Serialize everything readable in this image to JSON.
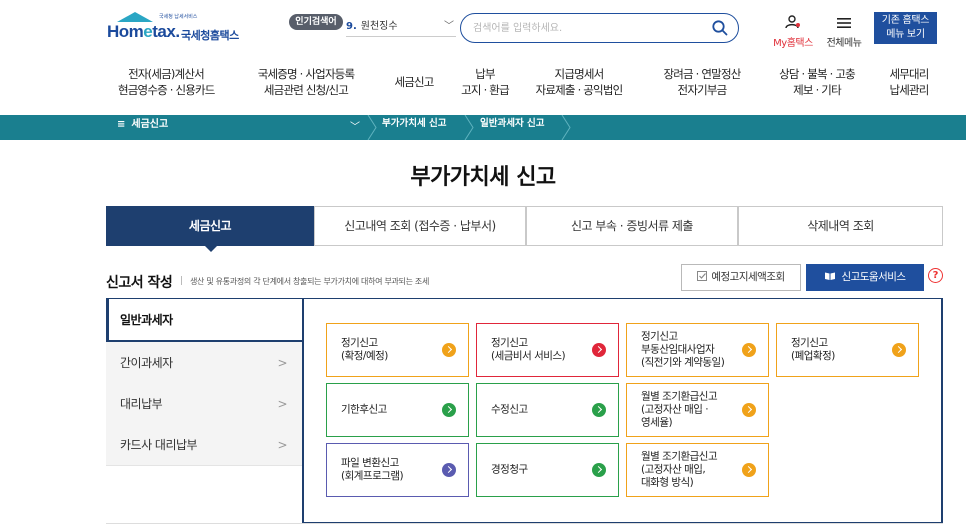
{
  "header": {
    "logo_text_a": "Hom",
    "logo_text_e": "e",
    "logo_text_b": "tax.",
    "logo_sub": "국세청홈택스",
    "logo_tiny": "국세청 납세서비스",
    "popular_badge": "인기검색어",
    "popular_num": "9.",
    "popular_term": "원천징수",
    "search_placeholder": "검색어를 입력하세요.",
    "my_hometax": "My홈택스",
    "all_menu": "전체메뉴",
    "old_hometax_line1": "기존 홈택스",
    "old_hometax_line2": "메뉴 보기"
  },
  "gnb": [
    {
      "line1": "전자(세금)계산서",
      "line2": "현금영수증 · 신용카드"
    },
    {
      "line1": "국세증명 · 사업자등록",
      "line2": "세금관련 신청/신고"
    },
    {
      "line1": "세금신고",
      "line2": ""
    },
    {
      "line1": "납부",
      "line2": "고지 · 환급"
    },
    {
      "line1": "지급명세서",
      "line2": "자료제출 · 공익법인"
    },
    {
      "line1": "장려금 · 연말정산",
      "line2": "전자기부금"
    },
    {
      "line1": "상담 · 불복 · 고충",
      "line2": "제보 · 기타"
    },
    {
      "line1": "세무대리",
      "line2": "납세관리"
    }
  ],
  "location": {
    "menu": "세금신고",
    "crumb1": "부가가치세 신고",
    "crumb2": "일반과세자 신고"
  },
  "page_title": "부가가치세 신고",
  "tabs": [
    "세금신고",
    "신고내역 조회 (접수증 · 납부서)",
    "신고 부속 · 증빙서류 제출",
    "삭제내역 조회"
  ],
  "section": {
    "title": "신고서 작성",
    "desc": "생산 및 유통과정의 각 단계에서 창출되는 부가가치에 대하여 부과되는 조세",
    "btn_notice": "예정고지세액조회",
    "btn_help": "신고도움서비스",
    "help_mark": "?"
  },
  "side_menu": [
    "일반과세자",
    "간이과세자",
    "대리납부",
    "카드사 대리납부"
  ],
  "colors": {
    "orange": "#f0a21a",
    "red": "#e0263a",
    "green": "#2aa04a",
    "purple": "#5a5bb0",
    "navy": "#1e3f6f",
    "teal": "#1a7f8f"
  },
  "cards": [
    {
      "label": "정기신고\n(확정/예정)",
      "color": "orange"
    },
    {
      "label": "정기신고\n(세금비서 서비스)",
      "color": "red"
    },
    {
      "label": "정기신고\n부동산임대사업자\n(직전기와 계약동일)",
      "color": "orange"
    },
    {
      "label": "정기신고\n(폐업확정)",
      "color": "orange"
    },
    {
      "label": "기한후신고",
      "color": "green"
    },
    {
      "label": "수정신고",
      "color": "green"
    },
    {
      "label": "월별 조기환급신고\n(고정자산 매입 ·\n영세율)",
      "color": "orange"
    },
    {
      "label": "파일 변환신고\n(회계프로그램)",
      "color": "purple"
    },
    {
      "label": "경정청구",
      "color": "green"
    },
    {
      "label": "월별 조기환급신고\n(고정자산 매입,\n대화형 방식)",
      "color": "orange"
    }
  ]
}
